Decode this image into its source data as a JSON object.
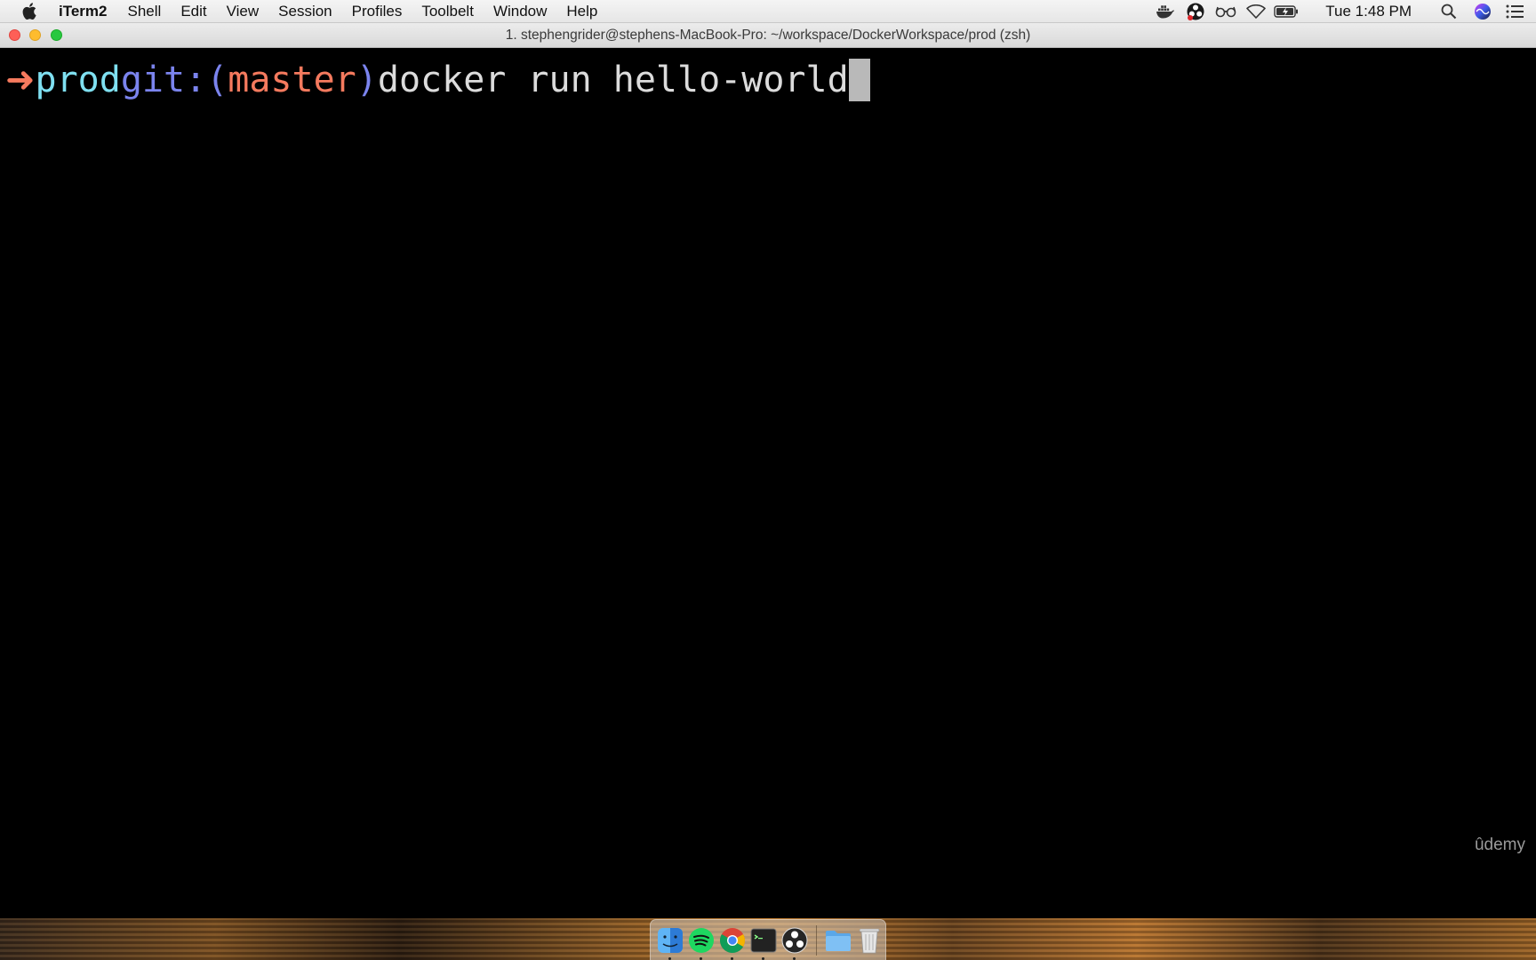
{
  "menubar": {
    "apple_icon": "apple-logo-icon",
    "app_name": "iTerm2",
    "menus": [
      "Shell",
      "Edit",
      "View",
      "Session",
      "Profiles",
      "Toolbelt",
      "Window",
      "Help"
    ],
    "status_icons": [
      "docker-whale-icon",
      "obs-icon",
      "glasses-icon",
      "wifi-icon",
      "battery-charging-icon"
    ],
    "clock": "Tue 1:48 PM",
    "right_icons": [
      "spotlight-search-icon",
      "siri-icon",
      "notification-center-icon"
    ]
  },
  "window": {
    "title": "1. stephengrider@stephens-MacBook-Pro: ~/workspace/DockerWorkspace/prod (zsh)"
  },
  "terminal": {
    "prompt_arrow": "➜",
    "directory": "prod",
    "git_prefix": "git:(",
    "branch": "master",
    "git_suffix": ")",
    "command": "docker run hello-world",
    "colors": {
      "arrow": "#f57a5e",
      "directory": "#7fe0f1",
      "git": "#7b84ee",
      "branch": "#f57a5e",
      "command": "#dcdcdc",
      "cursor": "#b9b9b9",
      "background": "#000000"
    }
  },
  "watermark": "ûdemy",
  "dock": {
    "apps": [
      "finder-icon",
      "spotify-icon",
      "chrome-icon",
      "terminal-icon",
      "obs-icon",
      "folder-icon",
      "trash-icon"
    ]
  }
}
